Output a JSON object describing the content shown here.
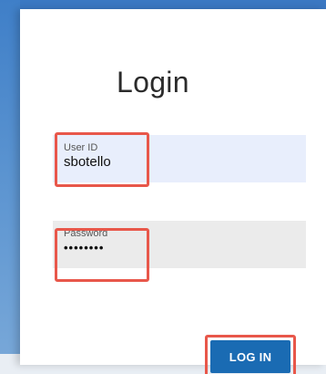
{
  "login_form": {
    "title": "Login",
    "user_id": {
      "label": "User ID",
      "value": "sbotello"
    },
    "password": {
      "label": "Password",
      "value": "••••••••"
    },
    "login_button": "LOG IN"
  },
  "colors": {
    "accent": "#1a6bb3",
    "highlight": "#e8574a",
    "background_blue": "#3b78c3"
  }
}
